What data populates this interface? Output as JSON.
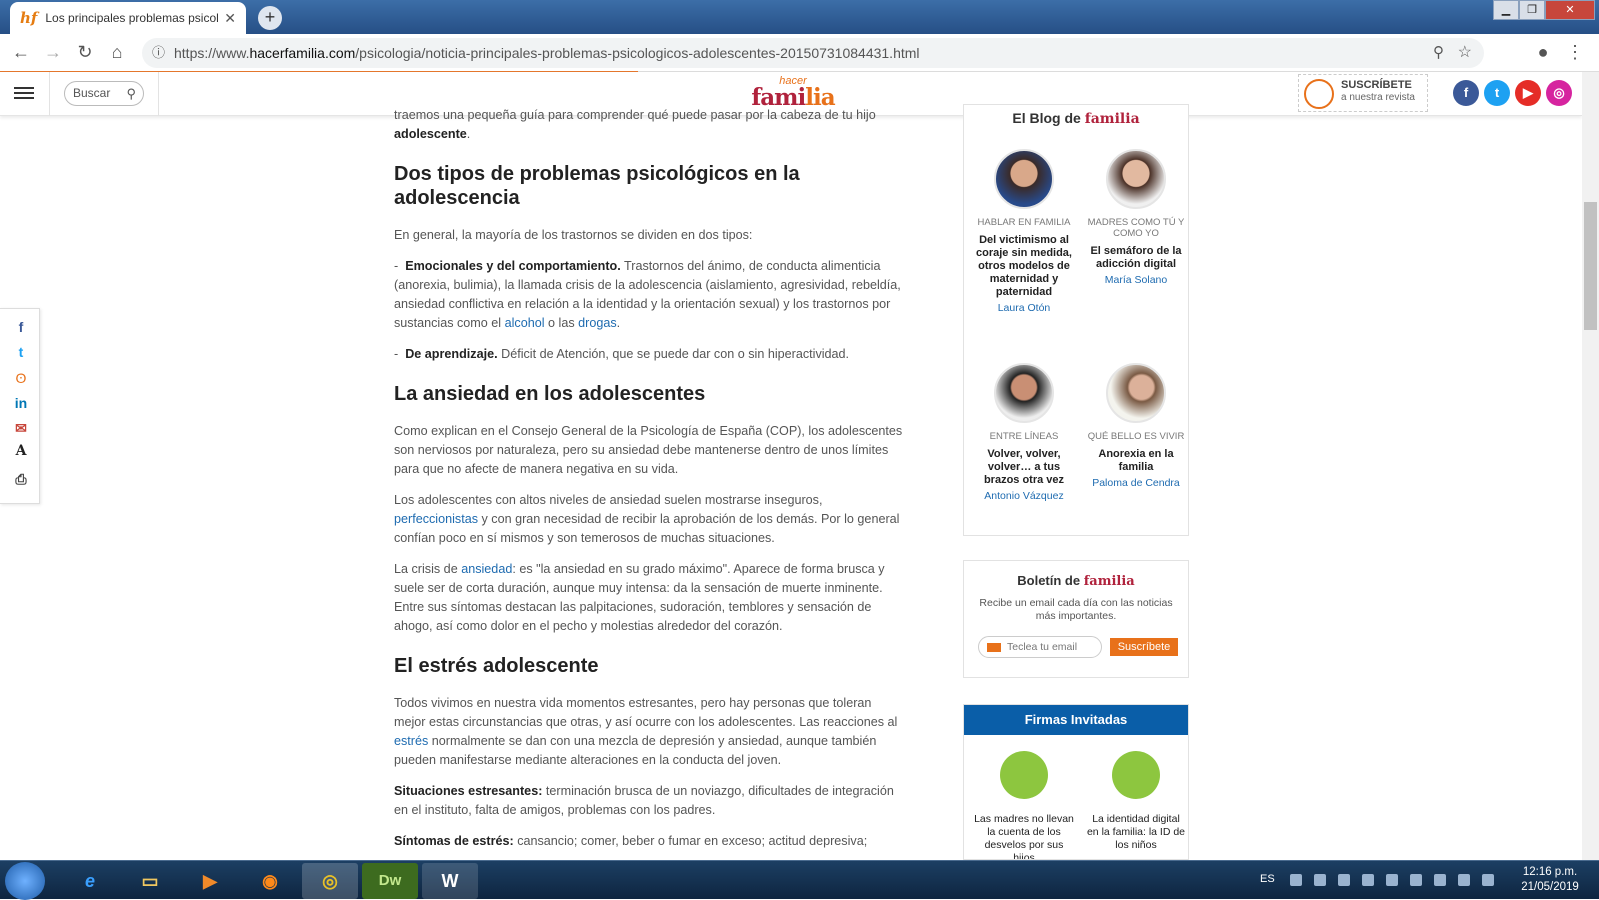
{
  "browser": {
    "tab_title": "Los principales problemas psicoló",
    "tab_favicon": "hf",
    "new_tab": "+",
    "url_prefix": "https://www.",
    "url_domain": "hacerfamilia.com",
    "url_path": "/psicologia/noticia-principales-problemas-psicologicos-adolescentes-20150731084431.html"
  },
  "site": {
    "search_placeholder": "Buscar",
    "logo_small": "hacer",
    "logo_main_a": "fami",
    "logo_main_b": "lia",
    "subscribe_title": "SUSCRÍBETE",
    "subscribe_sub": "a nuestra revista"
  },
  "article": {
    "intro_tail": "traemos una pequeña guía para comprender qué puede pasar por la cabeza de tu hijo",
    "intro_bold": "adolescente",
    "h1": "Dos tipos de problemas psicológicos en la adolescencia",
    "p1": "En general, la mayoría de los trastornos se dividen en dos tipos:",
    "p2_bold": "Emocionales y del comportamiento.",
    "p2_text": "Trastornos del ánimo, de conducta alimenticia (anorexia, bulimia), la llamada crisis de la adolescencia (aislamiento, agresividad, rebeldía, ansiedad conflictiva en relación a la identidad y la orientación sexual) y los trastornos por sustancias como el",
    "p2_link1": "alcohol",
    "p2_mid": "o las",
    "p2_link2": "drogas",
    "p3_bold": "De aprendizaje.",
    "p3_text": "Déficit de Atención, que se puede dar con o sin hiperactividad.",
    "h2": "La ansiedad en los adolescentes",
    "p4": "Como explican en el Consejo General de la Psicología de España (COP), los adolescentes son nerviosos por naturaleza, pero su ansiedad debe mantenerse dentro de unos límites para que no afecte de manera negativa en su vida.",
    "p5_a": "Los adolescentes con altos niveles de ansiedad suelen mostrarse inseguros,",
    "p5_link": "perfeccionistas",
    "p5_b": "y con gran necesidad de recibir la aprobación de los demás. Por lo general confían poco en sí mismos y son temerosos de muchas situaciones.",
    "p6_a": "La crisis de",
    "p6_link": "ansiedad",
    "p6_b": ": es \"la ansiedad en su grado máximo\". Aparece de forma brusca y suele ser de corta duración, aunque muy intensa: da la sensación de muerte inminente. Entre sus síntomas destacan las palpitaciones, sudoración, temblores y sensación de ahogo, así como dolor en el pecho y molestias alrededor del corazón.",
    "h3": "El estrés adolescente",
    "p7_a": "Todos vivimos en nuestra vida momentos estresantes, pero hay personas que toleran mejor estas circunstancias que otras, y así ocurre con los adolescentes. Las reacciones al",
    "p7_link": "estrés",
    "p7_b": "normalmente se dan con una mezcla de depresión y ansiedad, aunque también pueden manifestarse mediante alteraciones en la conducta del joven.",
    "p8_bold": "Situaciones estresantes:",
    "p8_text": "terminación brusca de un noviazgo, dificultades de integración en el instituto, falta de amigos, problemas con los padres.",
    "p9_bold": "Síntomas de estrés:",
    "p9_text": "cansancio; comer, beber o fumar en exceso; actitud depresiva;"
  },
  "blog": {
    "title": "El Blog de",
    "title_brand": "familia",
    "posts": [
      {
        "category": "HABLAR EN FAMILIA",
        "title": "Del victimismo al coraje sin medida, otros modelos de maternidad y paternidad",
        "author": "Laura Otón"
      },
      {
        "category": "MADRES COMO TÚ Y COMO YO",
        "title": "El semáforo de la adicción digital",
        "author": "María Solano"
      },
      {
        "category": "ENTRE LÍNEAS",
        "title": "Volver, volver, volver… a tus brazos otra vez",
        "author": "Antonio Vázquez"
      },
      {
        "category": "QUÉ BELLO ES VIVIR",
        "title": "Anorexia en la familia",
        "author": "Paloma de Cendra"
      }
    ]
  },
  "boletin": {
    "title": "Boletín de",
    "title_brand": "familia",
    "desc": "Recibe un email cada día con las noticias más importantes.",
    "email_placeholder": "Teclea tu email",
    "button": "Suscríbete"
  },
  "firmas": {
    "title": "Firmas Invitadas",
    "posts": [
      {
        "title": "Las madres no llevan la cuenta de los desvelos por sus hijos"
      },
      {
        "title": "La identidad digital en la familia: la ID de los niños"
      }
    ]
  },
  "taskbar": {
    "lang": "ES",
    "time": "12:16 p.m.",
    "date": "21/05/2019",
    "apps": [
      "ie-icon",
      "explorer-icon",
      "media-icon",
      "firefox-icon",
      "chrome-icon",
      "dreamweaver-icon",
      "word-icon"
    ],
    "dw_label": "Dw",
    "word_label": "W"
  },
  "colors": {
    "brand_orange": "#e8711a",
    "brand_red": "#b0223c",
    "link": "#1e6bb0",
    "firmas_blue": "#0a5ea8"
  }
}
